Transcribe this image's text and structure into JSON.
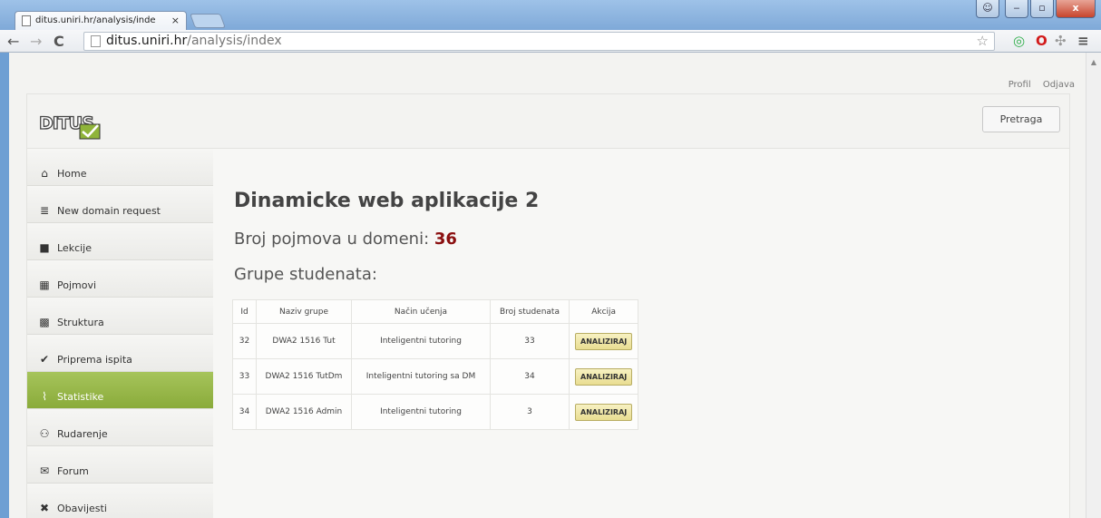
{
  "browser": {
    "tab_title": "ditus.uniri.hr/analysis/inde",
    "tab_close": "×",
    "url_host": "ditus.uniri.hr",
    "url_path": "/analysis/index"
  },
  "top_links": {
    "profil": "Profil",
    "odjava": "Odjava"
  },
  "header": {
    "logo_text": "DITUS",
    "search_button": "Pretraga"
  },
  "sidebar": {
    "items": [
      {
        "label": "Home",
        "icon": "home-icon",
        "glyph": "⌂"
      },
      {
        "label": "New domain request",
        "icon": "stack-icon",
        "glyph": "≣"
      },
      {
        "label": "Lekcije",
        "icon": "book-icon",
        "glyph": "■"
      },
      {
        "label": "Pojmovi",
        "icon": "grid-icon",
        "glyph": "▦"
      },
      {
        "label": "Struktura",
        "icon": "sitemap-icon",
        "glyph": "▩"
      },
      {
        "label": "Priprema ispita",
        "icon": "check-icon",
        "glyph": "✔"
      },
      {
        "label": "Statistike",
        "icon": "chart-icon",
        "glyph": "⌇",
        "active": true
      },
      {
        "label": "Rudarenje",
        "icon": "users-icon",
        "glyph": "⚇"
      },
      {
        "label": "Forum",
        "icon": "comments-icon",
        "glyph": "✉"
      },
      {
        "label": "Obavijesti",
        "icon": "bell-icon",
        "glyph": "✖"
      }
    ]
  },
  "main": {
    "title": "Dinamicke web aplikacije 2",
    "count_label": "Broj pojmova u domeni:",
    "count_value": "36",
    "groups_heading": "Grupe studenata:"
  },
  "table": {
    "headers": [
      "Id",
      "Naziv grupe",
      "Način učenja",
      "Broj studenata",
      "Akcija"
    ],
    "rows": [
      {
        "id": "32",
        "name": "DWA2 1516 Tut",
        "mode": "Inteligentni tutoring",
        "students": "33",
        "action": "ANALIZIRAJ"
      },
      {
        "id": "33",
        "name": "DWA2 1516 TutDm",
        "mode": "Inteligentni tutoring sa DM",
        "students": "34",
        "action": "ANALIZIRAJ"
      },
      {
        "id": "34",
        "name": "DWA2 1516 Admin",
        "mode": "Inteligentni tutoring",
        "students": "3",
        "action": "ANALIZIRAJ"
      }
    ]
  },
  "colors": {
    "accent": "#98b648",
    "count": "#8b1010",
    "button": "#ece291"
  }
}
